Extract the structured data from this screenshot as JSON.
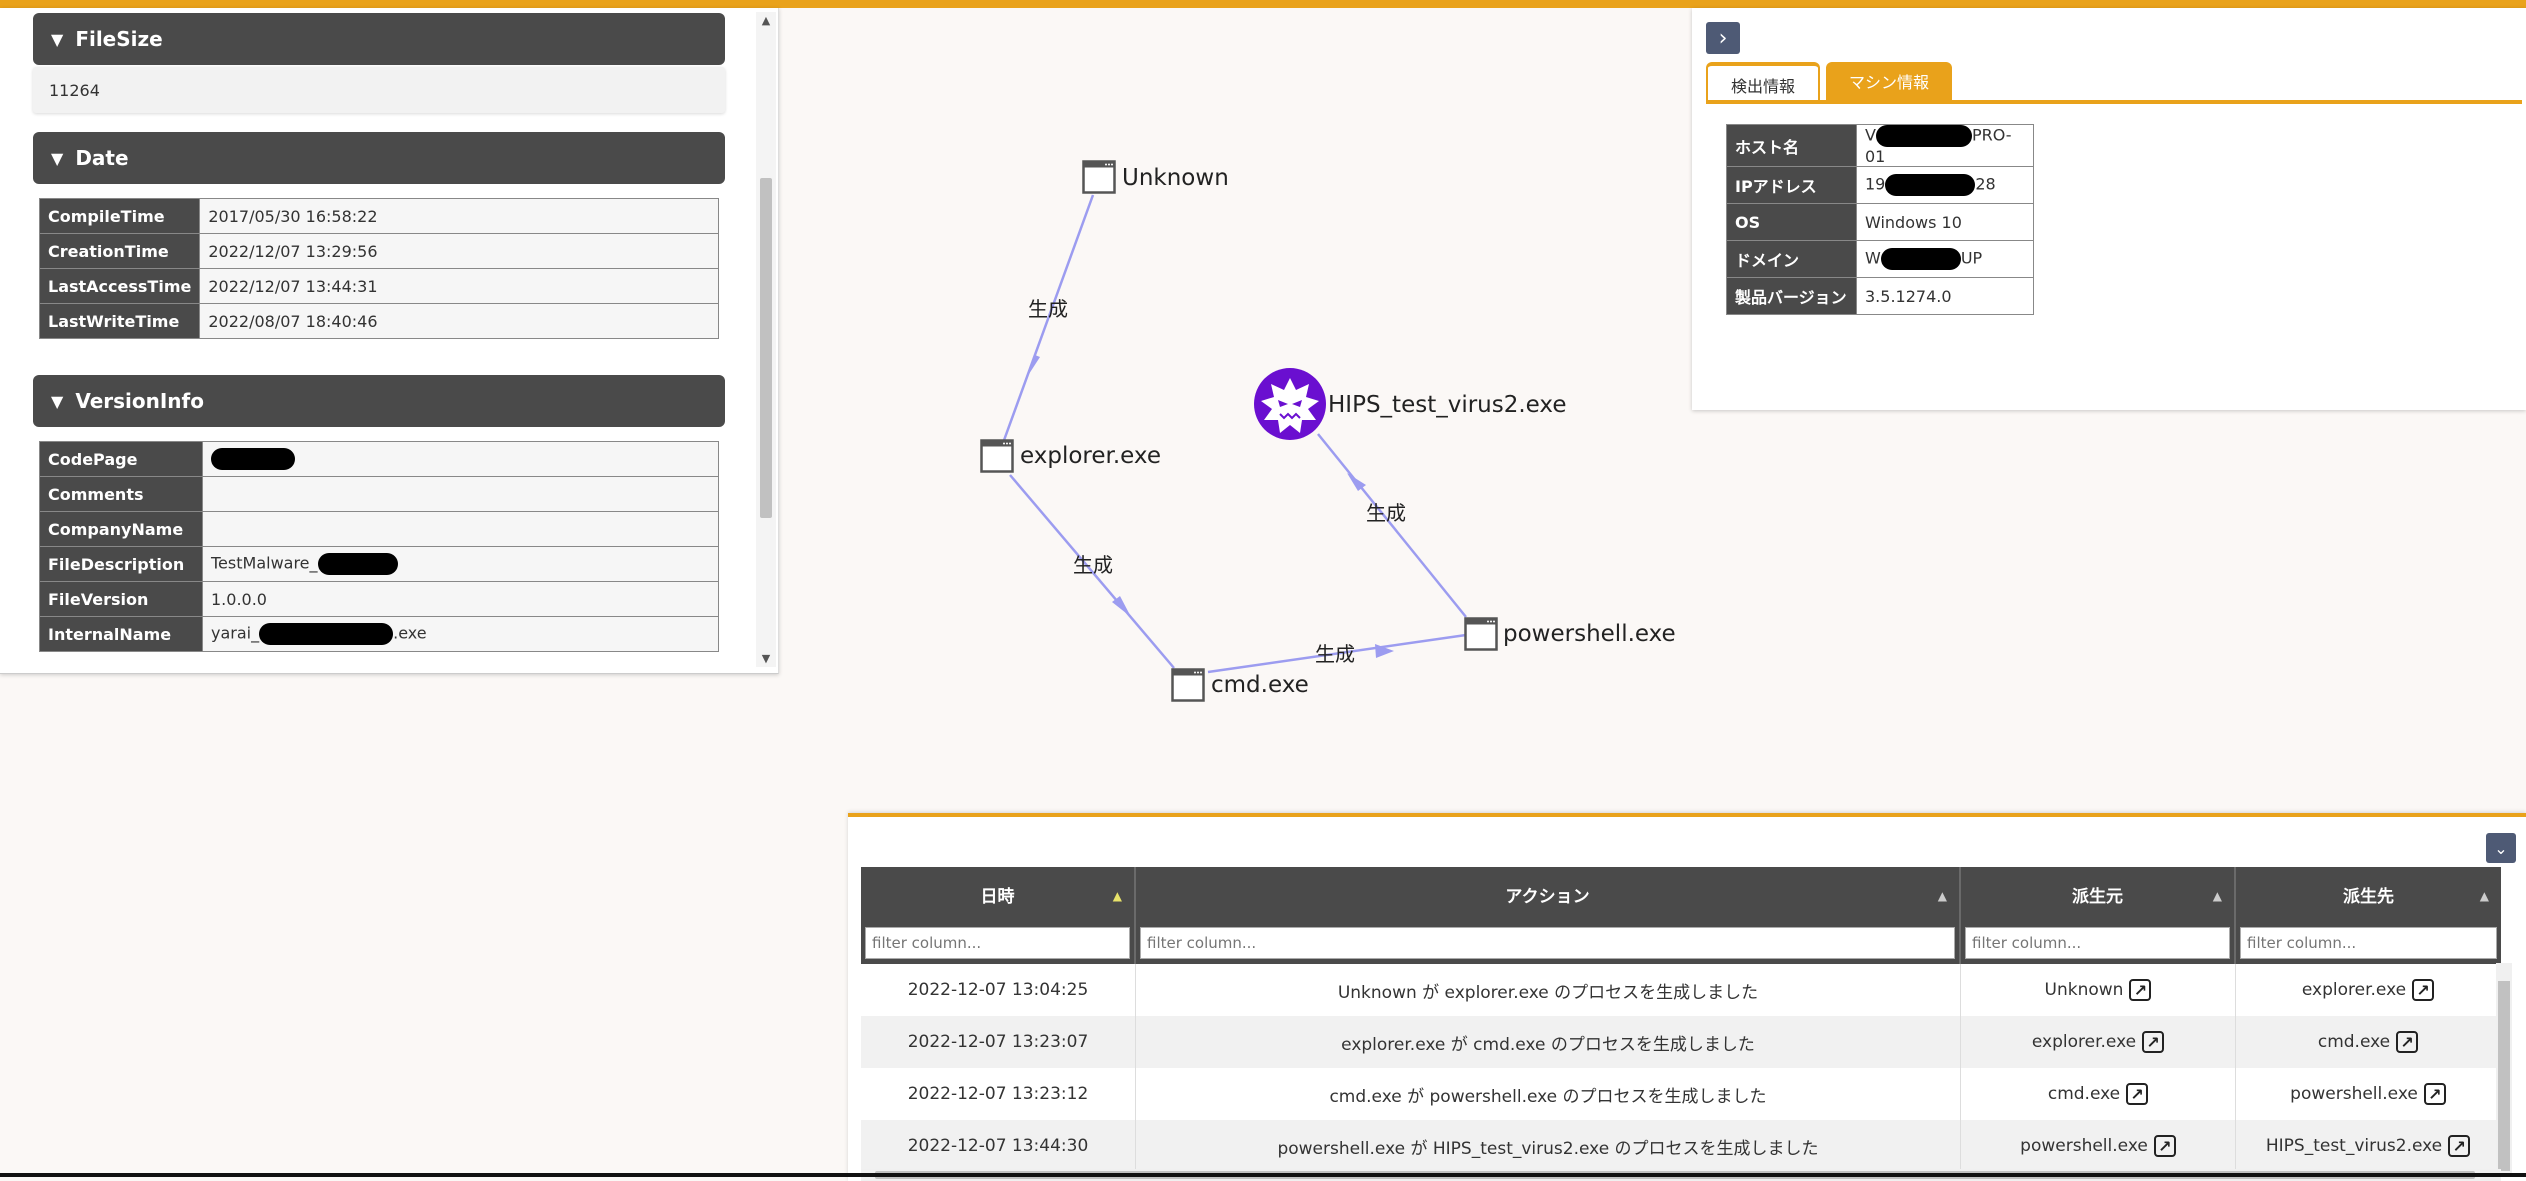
{
  "file_panel": {
    "filesize": {
      "header": "FileSize",
      "value": "11264"
    },
    "date": {
      "header": "Date",
      "rows": [
        {
          "key": "CompileTime",
          "value": "2017/05/30 16:58:22"
        },
        {
          "key": "CreationTime",
          "value": "2022/12/07 13:29:56"
        },
        {
          "key": "LastAccessTime",
          "value": "2022/12/07 13:44:31"
        },
        {
          "key": "LastWriteTime",
          "value": "2022/08/07 18:40:46"
        }
      ]
    },
    "versioninfo": {
      "header": "VersionInfo",
      "rows": [
        {
          "key": "CodePage",
          "value": ""
        },
        {
          "key": "Comments",
          "value": ""
        },
        {
          "key": "CompanyName",
          "value": ""
        },
        {
          "key": "FileDescription",
          "value": "TestMalware_"
        },
        {
          "key": "FileVersion",
          "value": "1.0.0.0"
        },
        {
          "key": "InternalName",
          "value": "yarai_",
          "suffix": ".exe"
        }
      ]
    }
  },
  "graph": {
    "nodes": [
      {
        "id": "unknown",
        "label": "Unknown"
      },
      {
        "id": "explorer",
        "label": "explorer.exe"
      },
      {
        "id": "cmd",
        "label": "cmd.exe"
      },
      {
        "id": "powershell",
        "label": "powershell.exe"
      },
      {
        "id": "virus",
        "label": "HIPS_test_virus2.exe"
      }
    ],
    "edge_label": "生成"
  },
  "machine_panel": {
    "tabs": [
      "検出情報",
      "マシン情報"
    ],
    "active_tab": "マシン情報",
    "rows": [
      {
        "key": "ホスト名",
        "prefix": "V",
        "suffix": "PRO-01"
      },
      {
        "key": "IPアドレス",
        "prefix": "19",
        "suffix": "28"
      },
      {
        "key": "OS",
        "value": "Windows 10"
      },
      {
        "key": "ドメイン",
        "prefix": "W",
        "suffix": "UP"
      },
      {
        "key": "製品バージョン",
        "value": "3.5.1274.0"
      }
    ]
  },
  "events_table": {
    "columns": [
      "日時",
      "アクション",
      "派生元",
      "派生先"
    ],
    "filter_placeholder": "filter column...",
    "rows": [
      {
        "datetime": "2022-12-07 13:04:25",
        "action": "Unknown が explorer.exe のプロセスを生成しました",
        "source": "Unknown",
        "target": "explorer.exe"
      },
      {
        "datetime": "2022-12-07 13:23:07",
        "action": "explorer.exe が cmd.exe のプロセスを生成しました",
        "source": "explorer.exe",
        "target": "cmd.exe"
      },
      {
        "datetime": "2022-12-07 13:23:12",
        "action": "cmd.exe が powershell.exe のプロセスを生成しました",
        "source": "cmd.exe",
        "target": "powershell.exe"
      },
      {
        "datetime": "2022-12-07 13:44:30",
        "action": "powershell.exe が HIPS_test_virus2.exe のプロセスを生成しました",
        "source": "powershell.exe",
        "target": "HIPS_test_virus2.exe"
      }
    ]
  },
  "icons": {
    "process": "window-icon",
    "malware": "virus-icon",
    "link": "external-link-icon",
    "expand": "chevron-right-icon",
    "collapse": "chevron-down-icon"
  },
  "colors": {
    "accent": "#e9a21b",
    "header_bg": "#4a4a4a",
    "edge": "#9c9cf0",
    "malware": "#6a0fd0",
    "button": "#4e5a75"
  }
}
